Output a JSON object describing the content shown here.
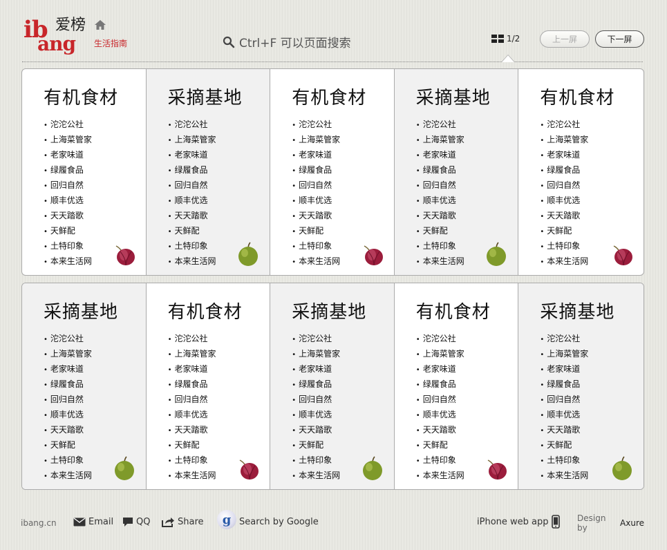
{
  "header": {
    "logo_ib": "ib",
    "logo_ang": "ang",
    "logo_cn": "爱榜",
    "logo_sub": "生活指南",
    "search_hint": "Ctrl+F 可以页面搜索",
    "page_indicator": "1/2",
    "prev_label": "上一屏",
    "next_label": "下一屏"
  },
  "colors": {
    "brand_red": "#c8262a",
    "card_alt_bg": "#f1f1f1"
  },
  "row1": [
    {
      "title": "有机食材",
      "fruit": "onion-icon",
      "items": [
        "沱沱公社",
        "上海菜管家",
        "老家味道",
        "绿履食品",
        "回归自然",
        "顺丰优选",
        "天天踏歌",
        "天鲜配",
        "土特印象",
        "本来生活网"
      ]
    },
    {
      "title": "采摘基地",
      "fruit": "apple-icon",
      "items": [
        "沱沱公社",
        "上海菜管家",
        "老家味道",
        "绿履食品",
        "回归自然",
        "顺丰优选",
        "天天踏歌",
        "天鲜配",
        "土特印象",
        "本来生活网"
      ]
    },
    {
      "title": "有机食材",
      "fruit": "onion-icon",
      "items": [
        "沱沱公社",
        "上海菜管家",
        "老家味道",
        "绿履食品",
        "回归自然",
        "顺丰优选",
        "天天踏歌",
        "天鲜配",
        "土特印象",
        "本来生活网"
      ]
    },
    {
      "title": "采摘基地",
      "fruit": "apple-icon",
      "items": [
        "沱沱公社",
        "上海菜管家",
        "老家味道",
        "绿履食品",
        "回归自然",
        "顺丰优选",
        "天天踏歌",
        "天鲜配",
        "土特印象",
        "本来生活网"
      ]
    },
    {
      "title": "有机食材",
      "fruit": "onion-icon",
      "items": [
        "沱沱公社",
        "上海菜管家",
        "老家味道",
        "绿履食品",
        "回归自然",
        "顺丰优选",
        "天天踏歌",
        "天鲜配",
        "土特印象",
        "本来生活网"
      ]
    }
  ],
  "row2": [
    {
      "title": "采摘基地",
      "fruit": "apple-icon",
      "items": [
        "沱沱公社",
        "上海菜管家",
        "老家味道",
        "绿履食品",
        "回归自然",
        "顺丰优选",
        "天天踏歌",
        "天鲜配",
        "土特印象",
        "本来生活网"
      ]
    },
    {
      "title": "有机食材",
      "fruit": "onion-icon",
      "items": [
        "沱沱公社",
        "上海菜管家",
        "老家味道",
        "绿履食品",
        "回归自然",
        "顺丰优选",
        "天天踏歌",
        "天鲜配",
        "土特印象",
        "本来生活网"
      ]
    },
    {
      "title": "采摘基地",
      "fruit": "apple-icon",
      "items": [
        "沱沱公社",
        "上海菜管家",
        "老家味道",
        "绿履食品",
        "回归自然",
        "顺丰优选",
        "天天踏歌",
        "天鲜配",
        "土特印象",
        "本来生活网"
      ]
    },
    {
      "title": "有机食材",
      "fruit": "onion-icon",
      "items": [
        "沱沱公社",
        "上海菜管家",
        "老家味道",
        "绿履食品",
        "回归自然",
        "顺丰优选",
        "天天踏歌",
        "天鲜配",
        "土特印象",
        "本来生活网"
      ]
    },
    {
      "title": "采摘基地",
      "fruit": "apple-icon",
      "items": [
        "沱沱公社",
        "上海菜管家",
        "老家味道",
        "绿履食品",
        "回归自然",
        "顺丰优选",
        "天天踏歌",
        "天鲜配",
        "土特印象",
        "本来生活网"
      ]
    }
  ],
  "footer": {
    "site": "ibang.cn",
    "email": "Email",
    "qq": "QQ",
    "share": "Share",
    "google_letter": "g",
    "google": "Search by Google",
    "iphone": "iPhone web app",
    "design_prefix": "Design by",
    "design_brand": "Axure"
  }
}
